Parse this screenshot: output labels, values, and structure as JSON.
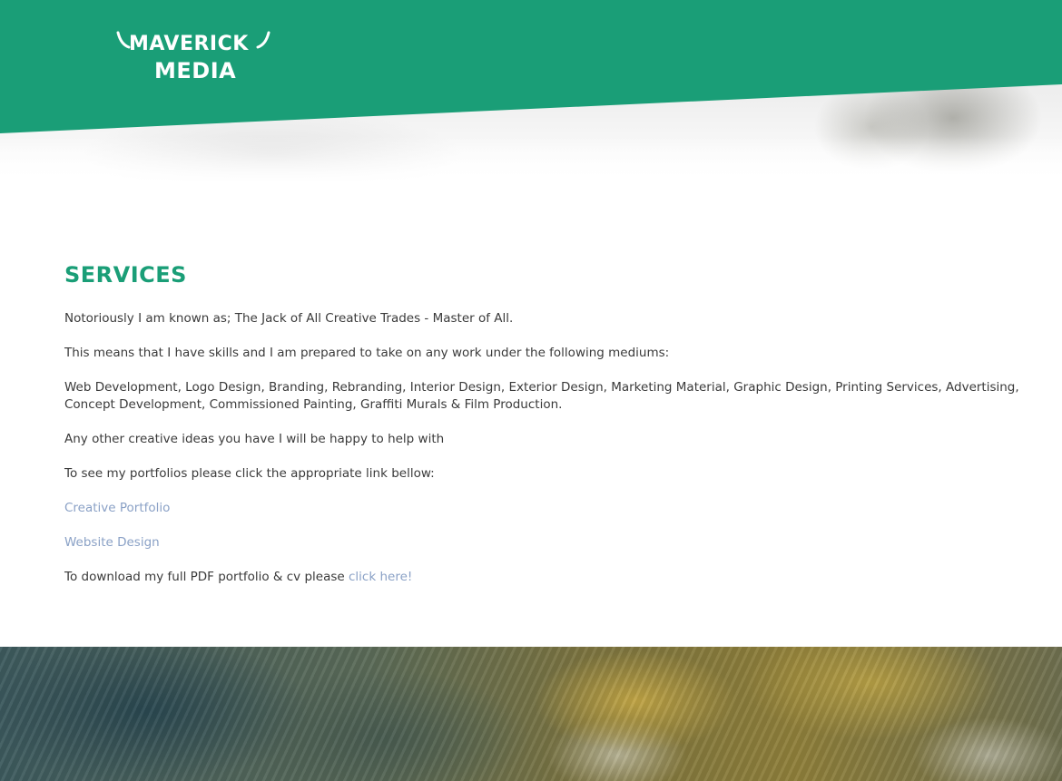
{
  "colors": {
    "brand_green": "#1a9e77",
    "link": "#8aa1c6",
    "body_text": "#3a3a3a"
  },
  "header": {
    "logo_line1": "MAVERICK",
    "logo_line2": "MEDIA",
    "logo_icon": "bull-horns-icon"
  },
  "services": {
    "title": "SERVICES",
    "intro": "Notoriously I am known as; The Jack of All Creative Trades - Master of All.",
    "skills_intro": "This means that I have skills and I am prepared to take on any work under the following mediums:",
    "mediums": "Web Development, Logo Design, Branding, Rebranding, Interior Design, Exterior Design, Marketing Material, Graphic Design, Printing Services, Advertising, Concept Development, Commissioned Painting, Graffiti Murals & Film Production.",
    "other_ideas": "Any other creative ideas you have I will be happy to help with",
    "portfolio_intro": "To see my portfolios please click the appropriate link bellow:",
    "link_creative": "Creative Portfolio",
    "link_website": "Website Design",
    "download_text": "To download my full PDF portfolio & cv please ",
    "download_link": "click here!"
  }
}
